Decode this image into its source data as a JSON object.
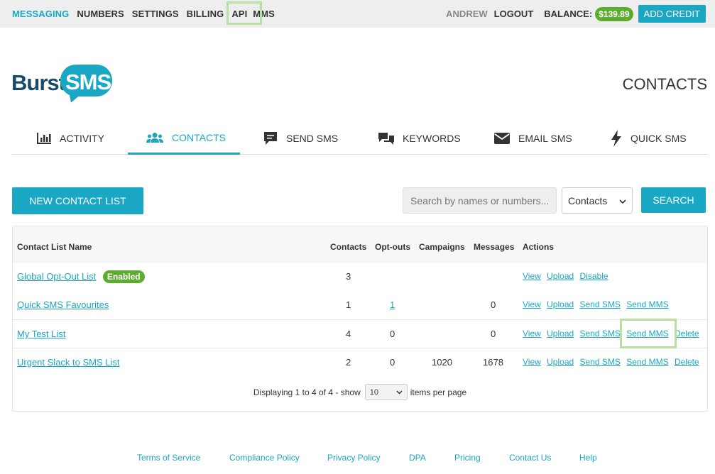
{
  "topnav": {
    "items": [
      "MESSAGING",
      "NUMBERS",
      "SETTINGS",
      "BILLING",
      "API",
      "MMS"
    ],
    "user": "ANDREW",
    "logout": "LOGOUT",
    "balance_label": "BALANCE:",
    "balance": "$139.89",
    "add_credit": "ADD CREDIT"
  },
  "logo": {
    "part1": "Burst",
    "part2": "SMS"
  },
  "page_title": "CONTACTS",
  "tabs": [
    {
      "label": "ACTIVITY",
      "icon": "chart-icon"
    },
    {
      "label": "CONTACTS",
      "icon": "users-icon"
    },
    {
      "label": "SEND SMS",
      "icon": "comment-icon"
    },
    {
      "label": "KEYWORDS",
      "icon": "comments-icon"
    },
    {
      "label": "EMAIL SMS",
      "icon": "envelope-icon"
    },
    {
      "label": "QUICK SMS",
      "icon": "bolt-icon"
    }
  ],
  "toolbar": {
    "new_list": "NEW CONTACT LIST",
    "search_placeholder": "Search by names or numbers...",
    "filter_selected": "Contacts",
    "search_button": "SEARCH"
  },
  "table": {
    "headers": [
      "Contact List Name",
      "Contacts",
      "Opt-outs",
      "Campaigns",
      "Messages",
      "Actions"
    ],
    "rows": [
      {
        "name": "Global Opt-Out List",
        "badge": "Enabled",
        "contacts": "3",
        "optouts": "",
        "campaigns": "",
        "messages": "",
        "actions": [
          "View",
          "Upload",
          "Disable"
        ]
      },
      {
        "name": "Quick SMS Favourites",
        "contacts": "1",
        "optouts": "1",
        "campaigns": "",
        "messages": "0",
        "actions": [
          "View",
          "Upload",
          "Send SMS",
          "Send MMS"
        ]
      },
      {
        "name": "My Test List",
        "contacts": "4",
        "optouts": "0",
        "campaigns": "",
        "messages": "0",
        "actions": [
          "View",
          "Upload",
          "Send SMS",
          "Send MMS",
          "Delete"
        ]
      },
      {
        "name": "Urgent Slack to SMS List",
        "contacts": "2",
        "optouts": "0",
        "campaigns": "1020",
        "messages": "1678",
        "actions": [
          "View",
          "Upload",
          "Send SMS",
          "Send MMS",
          "Delete"
        ]
      }
    ]
  },
  "pager": {
    "text_prefix": "Displaying",
    "from": "1",
    "to_word": "to",
    "to": "4",
    "of_word": "of",
    "total": "4",
    "show": "- show",
    "per_page": "10",
    "suffix": "items per page"
  },
  "footer": [
    "Terms of Service",
    "Compliance Policy",
    "Privacy Policy",
    "DPA",
    "Pricing",
    "Contact Us",
    "Help"
  ],
  "colors": {
    "accent": "#1aa7c4",
    "success": "#5cac2e",
    "highlight": "#b8e0a0"
  }
}
